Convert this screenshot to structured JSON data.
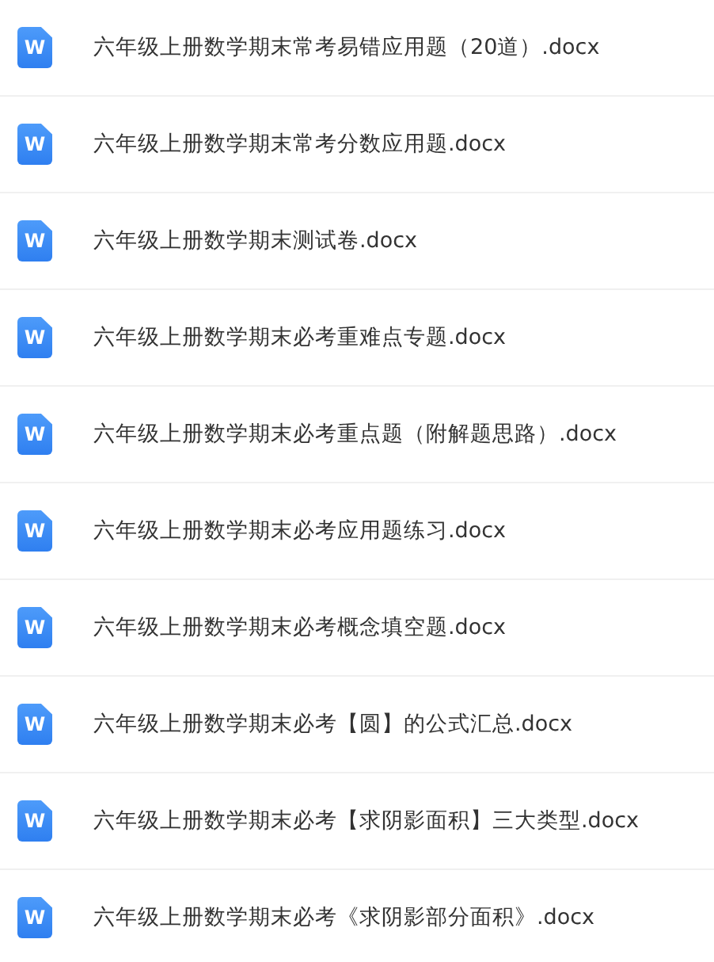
{
  "files": [
    {
      "name": "六年级上册数学期末常考易错应用题（20道）.docx",
      "icon_letter": "W"
    },
    {
      "name": "六年级上册数学期末常考分数应用题.docx",
      "icon_letter": "W"
    },
    {
      "name": "六年级上册数学期末测试卷.docx",
      "icon_letter": "W"
    },
    {
      "name": "六年级上册数学期末必考重难点专题.docx",
      "icon_letter": "W"
    },
    {
      "name": "六年级上册数学期末必考重点题（附解题思路）.docx",
      "icon_letter": "W"
    },
    {
      "name": "六年级上册数学期末必考应用题练习.docx",
      "icon_letter": "W"
    },
    {
      "name": "六年级上册数学期末必考概念填空题.docx",
      "icon_letter": "W"
    },
    {
      "name": "六年级上册数学期末必考【圆】的公式汇总.docx",
      "icon_letter": "W"
    },
    {
      "name": "六年级上册数学期末必考【求阴影面积】三大类型.docx",
      "icon_letter": "W"
    },
    {
      "name": "六年级上册数学期末必考《求阴影部分面积》.docx",
      "icon_letter": "W"
    }
  ]
}
